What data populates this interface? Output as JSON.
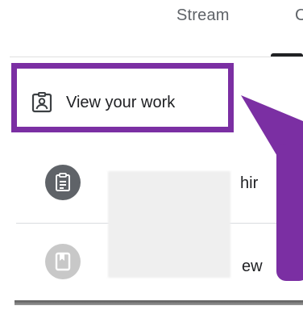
{
  "tabs": {
    "stream_label": "Stream",
    "partial_label": "C"
  },
  "highlight": {
    "label": "View your work",
    "icon": "assignment-ind-icon",
    "color": "#7b2fa3"
  },
  "list": {
    "rows": [
      {
        "partial_text": "hir",
        "icon": "assignment-icon"
      },
      {
        "partial_text": "ew",
        "icon": "bookmark-icon"
      }
    ]
  }
}
